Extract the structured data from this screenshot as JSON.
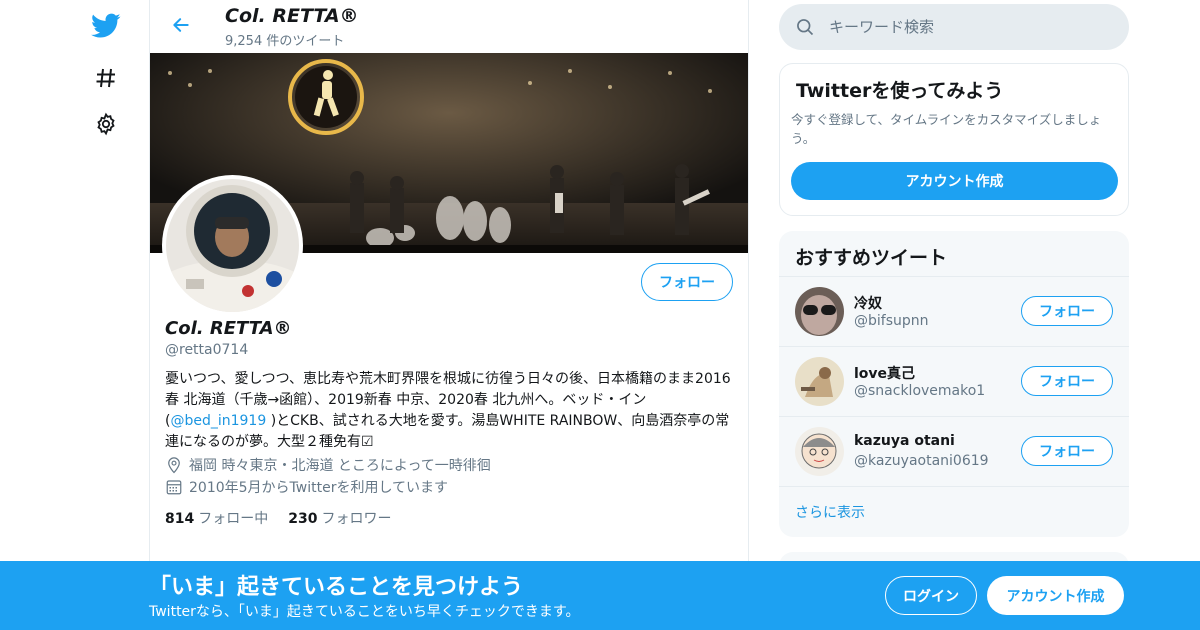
{
  "nav": {
    "icons": [
      "twitter-bird-icon",
      "hashtag-icon",
      "gear-icon"
    ]
  },
  "header": {
    "name": "Col. RETTA®",
    "tweet_count": "9,254 件のツイート"
  },
  "profile": {
    "follow_label": "フォロー",
    "name": "Col. RETTA®",
    "handle": "@retta0714",
    "bio_part1": "憂いつつ、愛しつつ、恵比寿や荒木町界隈を根城に彷徨う日々の後、日本橋籍のまま2016春 北海道（千歳→函館）、2019新春 中京、2020春 北九州へ。ベッド・イン(",
    "bio_mention": "@bed_in1919",
    "bio_part2": " )とCKB、試される大地を愛す。湯島WHITE RAINBOW、向島酒奈亭の常連になるのが夢。大型２種免有☑",
    "location": "福岡 時々東京・北海道 ところによって一時徘徊",
    "joined": "2010年5月からTwitterを利用しています",
    "following_count": "814",
    "following_label": "フォロー中",
    "followers_count": "230",
    "followers_label": "フォロワー"
  },
  "search": {
    "placeholder": "キーワード検索"
  },
  "signup_card": {
    "title": "Twitterを使ってみよう",
    "description": "今すぐ登録して、タイムラインをカスタマイズしましょう。",
    "button": "アカウント作成"
  },
  "recommendations": {
    "title": "おすすめツイート",
    "follow_label": "フォロー",
    "more_label": "さらに表示",
    "items": [
      {
        "name": "冷奴",
        "handle": "@bifsupnn"
      },
      {
        "name": "love真己",
        "handle": "@snacklovemako1"
      },
      {
        "name": "kazuya otani",
        "handle": "@kazuyaotani0619"
      }
    ]
  },
  "bottom_bar": {
    "title": "「いま」起きていることを見つけよう",
    "subtitle": "Twitterなら、「いま」起きていることをいち早くチェックできます。",
    "login": "ログイン",
    "signup": "アカウント作成"
  },
  "colors": {
    "accent": "#1da1f2",
    "link": "#1b95e0",
    "secondary_text": "#657786",
    "border": "#e6ecf0"
  }
}
